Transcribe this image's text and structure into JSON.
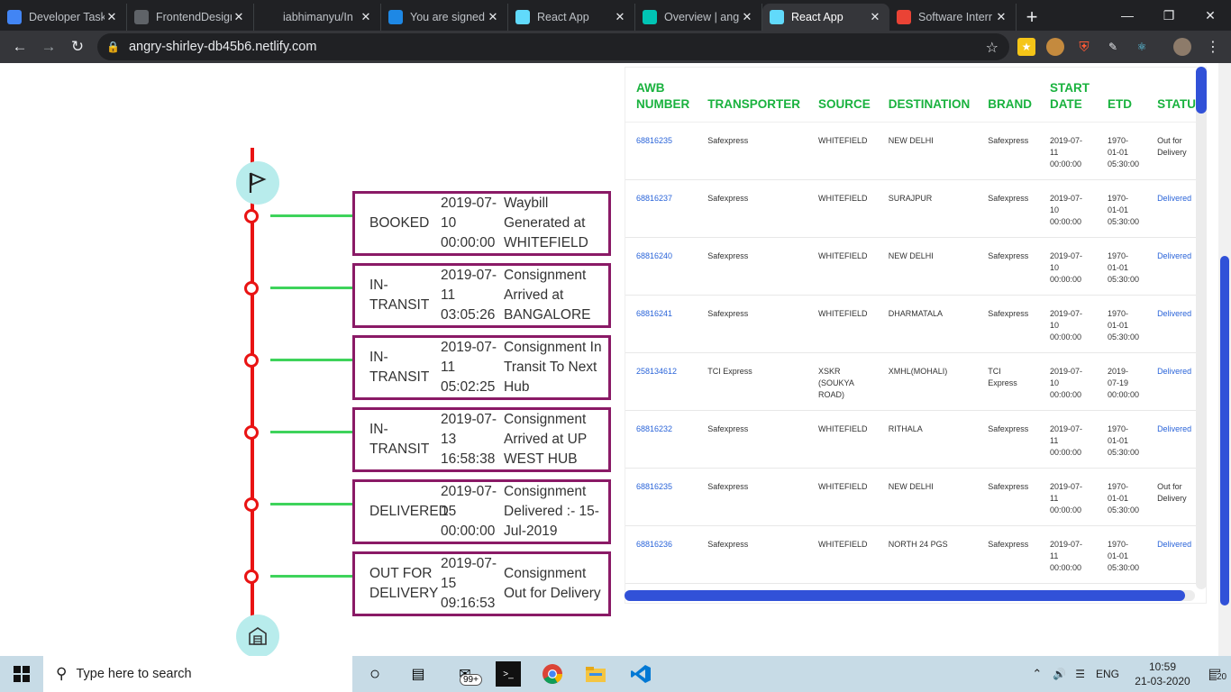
{
  "browser": {
    "tabs": [
      {
        "title": "Developer Task",
        "icon": "docs-icon",
        "color": "#4285f4"
      },
      {
        "title": "FrontendDesign",
        "icon": "globe-icon",
        "color": "#5f6368"
      },
      {
        "title": "iabhimanyu/In",
        "icon": "github-icon",
        "color": "#202124"
      },
      {
        "title": "You are signed",
        "icon": "s-icon",
        "color": "#1e88e5"
      },
      {
        "title": "React App",
        "icon": "react-icon",
        "color": "#61dafb"
      },
      {
        "title": "Overview | ang",
        "icon": "diamond-icon",
        "color": "#00c4b4"
      },
      {
        "title": "React App",
        "icon": "react-icon",
        "color": "#61dafb",
        "active": true
      },
      {
        "title": "Software Interr",
        "icon": "gmail-icon",
        "color": "#ea4335"
      }
    ],
    "url": "angry-shirley-db45b6.netlify.com"
  },
  "timeline": [
    {
      "status": "BOOKED",
      "date": "2019-07-10 00:00:00",
      "desc": "Waybill Generated at WHITEFIELD"
    },
    {
      "status": "IN-TRANSIT",
      "date": "2019-07-11 03:05:26",
      "desc": "Consignment Arrived at BANGALORE"
    },
    {
      "status": "IN-TRANSIT",
      "date": "2019-07-11 05:02:25",
      "desc": "Consignment In Transit To Next Hub"
    },
    {
      "status": "IN-TRANSIT",
      "date": "2019-07-13 16:58:38",
      "desc": "Consignment Arrived at UP WEST HUB"
    },
    {
      "status": "DELIVERED",
      "date": "2019-07-15 00:00:00",
      "desc": "Consignment Delivered :- 15-Jul-2019"
    },
    {
      "status": "OUT FOR DELIVERY",
      "date": "2019-07-15 09:16:53",
      "desc": "Consignment Out for Delivery"
    }
  ],
  "table": {
    "headers": [
      "AWB NUMBER",
      "TRANSPORTER",
      "SOURCE",
      "DESTINATION",
      "BRAND",
      "START DATE",
      "ETD",
      "STATUS"
    ],
    "rows": [
      [
        "68816235",
        "Safexpress",
        "WHITEFIELD",
        "NEW DELHI",
        "Safexpress",
        "2019-07-11 00:00:00",
        "1970-01-01 05:30:00",
        "Out for Delivery"
      ],
      [
        "68816237",
        "Safexpress",
        "WHITEFIELD",
        "SURAJPUR",
        "Safexpress",
        "2019-07-10 00:00:00",
        "1970-01-01 05:30:00",
        "Delivered"
      ],
      [
        "68816240",
        "Safexpress",
        "WHITEFIELD",
        "NEW DELHI",
        "Safexpress",
        "2019-07-10 00:00:00",
        "1970-01-01 05:30:00",
        "Delivered"
      ],
      [
        "68816241",
        "Safexpress",
        "WHITEFIELD",
        "DHARMATALA",
        "Safexpress",
        "2019-07-10 00:00:00",
        "1970-01-01 05:30:00",
        "Delivered"
      ],
      [
        "258134612",
        "TCI Express",
        "XSKR (SOUKYA ROAD)",
        "XMHL(MOHALI)",
        "TCI Express",
        "2019-07-10 00:00:00",
        "2019-07-19 00:00:00",
        "Delivered"
      ],
      [
        "68816232",
        "Safexpress",
        "WHITEFIELD",
        "RITHALA",
        "Safexpress",
        "2019-07-11 00:00:00",
        "1970-01-01 05:30:00",
        "Delivered"
      ],
      [
        "68816235",
        "Safexpress",
        "WHITEFIELD",
        "NEW DELHI",
        "Safexpress",
        "2019-07-11 00:00:00",
        "1970-01-01 05:30:00",
        "Out for Delivery"
      ],
      [
        "68816236",
        "Safexpress",
        "WHITEFIELD",
        "NORTH 24 PGS",
        "Safexpress",
        "2019-07-11 00:00:00",
        "1970-01-01 05:30:00",
        "Delivered"
      ]
    ]
  },
  "taskbar": {
    "search_placeholder": "Type here to search",
    "badge": "99+",
    "language": "ENG",
    "time": "10:59",
    "date": "21-03-2020",
    "notifications": "20"
  }
}
